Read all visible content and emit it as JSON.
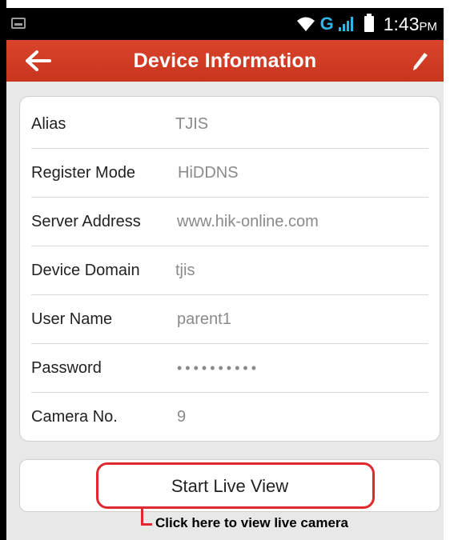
{
  "status_bar": {
    "network_type": "G",
    "time": "1:43",
    "ampm": "PM"
  },
  "header": {
    "title": "Device Information",
    "back_icon": "back-arrow-icon",
    "edit_icon": "pencil-icon",
    "color": "#d13d26"
  },
  "fields": [
    {
      "label": "Alias",
      "value": "TJIS"
    },
    {
      "label": "Register Mode",
      "value": "HiDDNS"
    },
    {
      "label": "Server Address",
      "value": "www.hik-online.com"
    },
    {
      "label": "Device Domain",
      "value": "tjis"
    },
    {
      "label": "User Name",
      "value": "parent1"
    },
    {
      "label": "Password",
      "value": "••••••••••"
    },
    {
      "label": "Camera No.",
      "value": "9"
    }
  ],
  "start_button": {
    "label": "Start Live View"
  },
  "annotation": {
    "text": "Click here to view live camera",
    "color": "#e0282f"
  }
}
